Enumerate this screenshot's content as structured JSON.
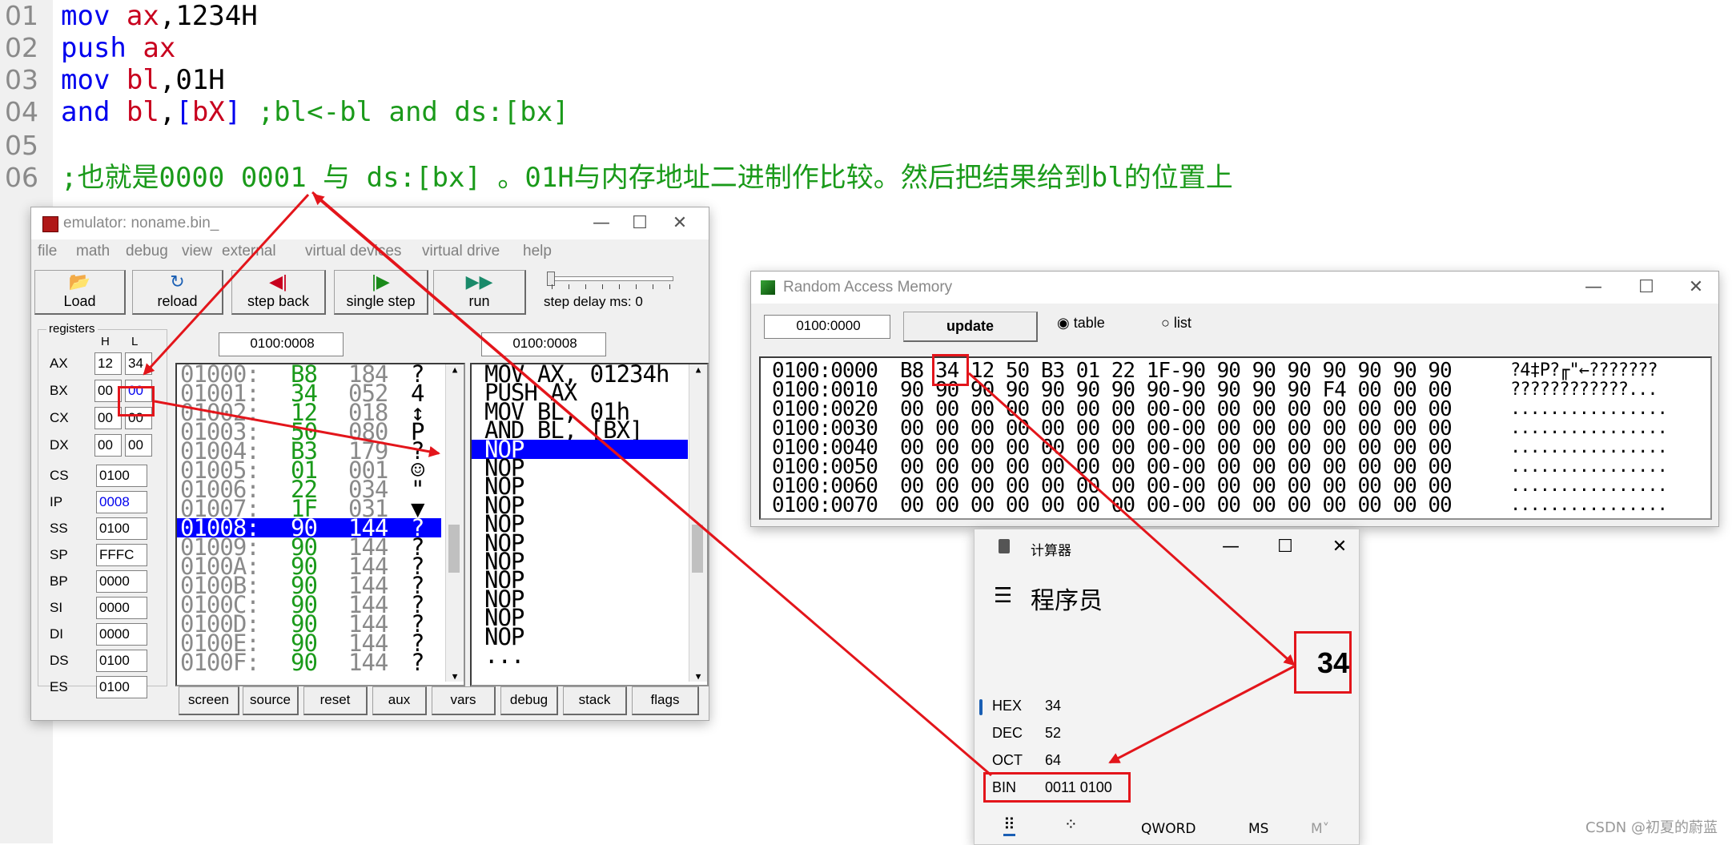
{
  "editor": {
    "lines": [
      {
        "num": "01",
        "parts": [
          {
            "t": "mov ",
            "c": "kw"
          },
          {
            "t": "ax",
            "c": "rg"
          },
          {
            "t": ",1234H",
            "c": "nb"
          }
        ]
      },
      {
        "num": "02",
        "parts": [
          {
            "t": "push ",
            "c": "kw"
          },
          {
            "t": "ax",
            "c": "rg"
          }
        ]
      },
      {
        "num": "03",
        "parts": [
          {
            "t": "mov ",
            "c": "kw"
          },
          {
            "t": "bl",
            "c": "rg"
          },
          {
            "t": ",01H",
            "c": "nb"
          }
        ]
      },
      {
        "num": "04",
        "parts": [
          {
            "t": "and ",
            "c": "kw"
          },
          {
            "t": "bl",
            "c": "rg"
          },
          {
            "t": ",",
            "c": "nb"
          },
          {
            "t": "[",
            "c": "kw"
          },
          {
            "t": "bX",
            "c": "rg"
          },
          {
            "t": "]",
            "c": "kw"
          },
          {
            "t": " ;bl<-bl and ds:[bx]",
            "c": "cm"
          }
        ]
      },
      {
        "num": "05",
        "parts": []
      },
      {
        "num": "06",
        "parts": [
          {
            "t": ";也就是0000 0001 与 ds:[bx] 。01H与内存地址二进制作比较。然后把结果给到bl的位置上",
            "c": "cm"
          }
        ]
      }
    ]
  },
  "emulator": {
    "title": "emulator: noname.bin_",
    "menu": [
      "file",
      "math",
      "debug",
      "view",
      "external",
      "virtual devices",
      "virtual drive",
      "help"
    ],
    "toolbar": [
      {
        "label": "Load",
        "icon": "open-folder-icon",
        "glyph": "📂"
      },
      {
        "label": "reload",
        "icon": "reload-icon",
        "glyph": "↻"
      },
      {
        "label": "step back",
        "icon": "step-back-icon",
        "glyph": "◀|"
      },
      {
        "label": "single step",
        "icon": "single-step-icon",
        "glyph": "|▶"
      },
      {
        "label": "run",
        "icon": "run-icon",
        "glyph": "▶▶"
      }
    ],
    "step_delay": "step delay ms: 0",
    "registers_label": "registers",
    "col_h": "H",
    "col_l": "L",
    "regs8": [
      {
        "name": "AX",
        "h": "12",
        "l": "34"
      },
      {
        "name": "BX",
        "h": "00",
        "l": "00"
      },
      {
        "name": "CX",
        "h": "00",
        "l": "00"
      },
      {
        "name": "DX",
        "h": "00",
        "l": "00"
      }
    ],
    "regs16": [
      {
        "name": "CS",
        "v": "0100"
      },
      {
        "name": "IP",
        "v": "0008"
      },
      {
        "name": "SS",
        "v": "0100"
      },
      {
        "name": "SP",
        "v": "FFFC"
      },
      {
        "name": "BP",
        "v": "0000"
      },
      {
        "name": "SI",
        "v": "0000"
      },
      {
        "name": "DI",
        "v": "0000"
      },
      {
        "name": "DS",
        "v": "0100"
      },
      {
        "name": "ES",
        "v": "0100"
      }
    ],
    "addr_left": "0100:0008",
    "addr_right": "0100:0008",
    "memory": [
      {
        "a": "01000:",
        "h": "B8",
        "d": "184",
        "c": "?"
      },
      {
        "a": "01001:",
        "h": "34",
        "d": "052",
        "c": "4"
      },
      {
        "a": "01002:",
        "h": "12",
        "d": "018",
        "c": "↕"
      },
      {
        "a": "01003:",
        "h": "50",
        "d": "080",
        "c": "P"
      },
      {
        "a": "01004:",
        "h": "B3",
        "d": "179",
        "c": "?"
      },
      {
        "a": "01005:",
        "h": "01",
        "d": "001",
        "c": "☺"
      },
      {
        "a": "01006:",
        "h": "22",
        "d": "034",
        "c": "\""
      },
      {
        "a": "01007:",
        "h": "1F",
        "d": "031",
        "c": "▼"
      },
      {
        "a": "01008:",
        "h": "90",
        "d": "144",
        "c": "?"
      },
      {
        "a": "01009:",
        "h": "90",
        "d": "144",
        "c": "?"
      },
      {
        "a": "0100A:",
        "h": "90",
        "d": "144",
        "c": "?"
      },
      {
        "a": "0100B:",
        "h": "90",
        "d": "144",
        "c": "?"
      },
      {
        "a": "0100C:",
        "h": "90",
        "d": "144",
        "c": "?"
      },
      {
        "a": "0100D:",
        "h": "90",
        "d": "144",
        "c": "?"
      },
      {
        "a": "0100E:",
        "h": "90",
        "d": "144",
        "c": "?"
      },
      {
        "a": "0100F:",
        "h": "90",
        "d": "144",
        "c": "?"
      }
    ],
    "memory_selected": 8,
    "disasm": [
      "MOV AX, 01234h",
      "PUSH AX",
      "MOV BL, 01h",
      "AND BL, [BX]",
      "NOP",
      "NOP",
      "NOP",
      "NOP",
      "NOP",
      "NOP",
      "NOP",
      "NOP",
      "NOP",
      "NOP",
      "NOP",
      "..."
    ],
    "disasm_selected": 4,
    "bottom_buttons": [
      "screen",
      "source",
      "reset",
      "aux",
      "vars",
      "debug",
      "stack",
      "flags"
    ]
  },
  "ram": {
    "title": "Random Access Memory",
    "address": "0100:0000",
    "update_label": "update",
    "radio_table": "table",
    "radio_list": "list",
    "rows": [
      {
        "a": "0100:0000",
        "b": "B8 34 12 50 B3 01 22 1F-90 90 90 90 90 90 90 90",
        "s": "?4‡P?╓\"←???????"
      },
      {
        "a": "0100:0010",
        "b": "90 90 90 90 90 90 90 90-90 90 90 90 F4 00 00 00",
        "s": "????????????..."
      },
      {
        "a": "0100:0020",
        "b": "00 00 00 00 00 00 00 00-00 00 00 00 00 00 00 00",
        "s": "................"
      },
      {
        "a": "0100:0030",
        "b": "00 00 00 00 00 00 00 00-00 00 00 00 00 00 00 00",
        "s": "................"
      },
      {
        "a": "0100:0040",
        "b": "00 00 00 00 00 00 00 00-00 00 00 00 00 00 00 00",
        "s": "................"
      },
      {
        "a": "0100:0050",
        "b": "00 00 00 00 00 00 00 00-00 00 00 00 00 00 00 00",
        "s": "................"
      },
      {
        "a": "0100:0060",
        "b": "00 00 00 00 00 00 00 00-00 00 00 00 00 00 00 00",
        "s": "................"
      },
      {
        "a": "0100:0070",
        "b": "00 00 00 00 00 00 00 00-00 00 00 00 00 00 00 00",
        "s": "................"
      }
    ]
  },
  "calc": {
    "title": "计算器",
    "mode": "程序员",
    "display": "34",
    "rows": [
      {
        "k": "HEX",
        "v": "34"
      },
      {
        "k": "DEC",
        "v": "52"
      },
      {
        "k": "OCT",
        "v": "64"
      },
      {
        "k": "BIN",
        "v": "0011 0100"
      }
    ],
    "bottom": [
      "QWORD",
      "MS",
      "M˅"
    ]
  },
  "watermark": "CSDN @初夏的蔚蓝",
  "colors": {
    "highlight": "#e3151b",
    "selection": "#0000ff",
    "green_text": "#1a9a1a",
    "keyword": "#0000ee",
    "register": "#c8001e"
  }
}
